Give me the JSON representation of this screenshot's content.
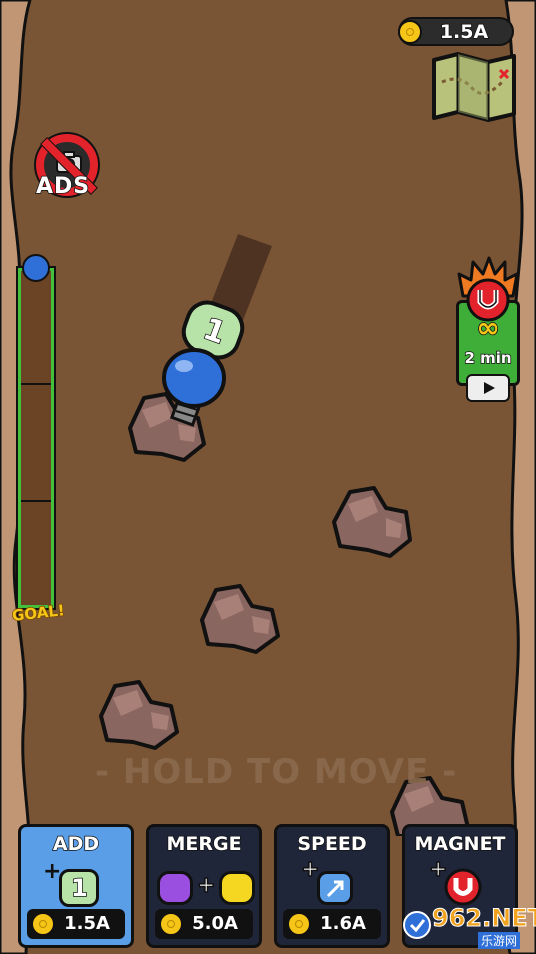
{
  "hud": {
    "coins": "1.5A",
    "no_ads_label": "ADS",
    "goal_label": "GOAL!",
    "progress_level": 0.0
  },
  "boost": {
    "infinity": "∞",
    "duration": "2 min"
  },
  "hint": "- HOLD TO MOVE -",
  "player": {
    "count": "1"
  },
  "cards": [
    {
      "title": "ADD",
      "price": "1.5A",
      "icon_value": "1"
    },
    {
      "title": "MERGE",
      "price": "5.0A"
    },
    {
      "title": "SPEED",
      "price": "1.6A"
    },
    {
      "title": "MAGNET",
      "price": ""
    }
  ],
  "watermark": {
    "brand": "962.NET",
    "sub": "乐游网"
  },
  "colors": {
    "dirt": "#7a5535",
    "wall": "#c09674",
    "accent_blue": "#2f6fd8",
    "progress_green": "#44c13b",
    "magnet_red": "#e3232b",
    "coin": "#f5c518"
  }
}
